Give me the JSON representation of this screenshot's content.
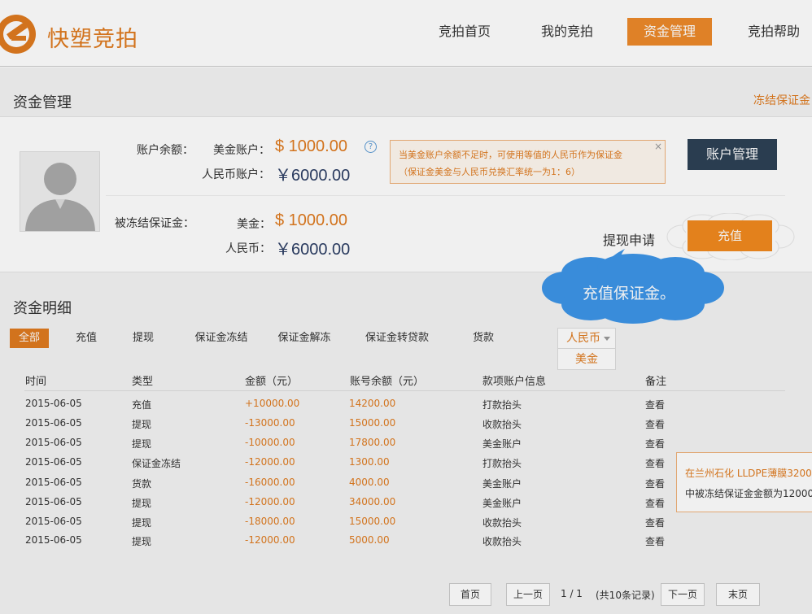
{
  "brand": {
    "name": "快塑竞拍"
  },
  "nav": [
    {
      "label": "竞拍首页",
      "active": false
    },
    {
      "label": "我的竞拍",
      "active": false
    },
    {
      "label": "资金管理",
      "active": true
    },
    {
      "label": "竞拍帮助",
      "active": false
    }
  ],
  "funds": {
    "title": "资金管理",
    "frozen_link": "冻结保证金",
    "balance_label": "账户余额：",
    "usd_label": "美金账户：",
    "usd_value": "$ 1000.00",
    "cny_label": "人民币账户：",
    "cny_value": "￥6000.00",
    "frozen_label": "被冻结保证金：",
    "frozen_usd_label": "美金：",
    "frozen_usd_value": "$ 1000.00",
    "frozen_cny_label": "人民币：",
    "frozen_cny_value": "￥6000.00",
    "help_icon": "?",
    "tip_line1": "当美金账户余额不足时，可使用等值的人民币作为保证金",
    "tip_line2": "（保证金美金与人民币兑换汇率统一为1：6）",
    "tip_close": "×",
    "account_button": "账户管理",
    "withdraw_link": "提现申请",
    "recharge_button": "充值",
    "guide_bubble": "充值保证金。"
  },
  "details": {
    "title": "资金明细",
    "filters": [
      "全部",
      "充值",
      "提现",
      "保证金冻结",
      "保证金解冻",
      "保证金转贷款",
      "货款"
    ],
    "active_filter": "全部",
    "currency_selected": "人民币",
    "currency_option": "美金",
    "columns": [
      "时间",
      "类型",
      "金额（元）",
      "账号余额（元）",
      "款项账户信息",
      "备注"
    ],
    "rows": [
      {
        "date": "2015-06-05",
        "type": "充值",
        "amount": "+10000.00",
        "balance": "14200.00",
        "account": "打款抬头",
        "note": "查看"
      },
      {
        "date": "2015-06-05",
        "type": "提现",
        "amount": "-13000.00",
        "balance": "15000.00",
        "account": "收款抬头",
        "note": "查看"
      },
      {
        "date": "2015-06-05",
        "type": "提现",
        "amount": "-10000.00",
        "balance": "17800.00",
        "account": "美金账户",
        "note": "查看"
      },
      {
        "date": "2015-06-05",
        "type": "保证金冻结",
        "amount": "-12000.00",
        "balance": "1300.00",
        "account": "打款抬头",
        "note": "查看"
      },
      {
        "date": "2015-06-05",
        "type": "货款",
        "amount": "-16000.00",
        "balance": "4000.00",
        "account": "美金账户",
        "note": "查看"
      },
      {
        "date": "2015-06-05",
        "type": "提现",
        "amount": "-12000.00",
        "balance": "34000.00",
        "account": "美金账户",
        "note": "查看"
      },
      {
        "date": "2015-06-05",
        "type": "提现",
        "amount": "-18000.00",
        "balance": "15000.00",
        "account": "收款抬头",
        "note": "查看"
      },
      {
        "date": "2015-06-05",
        "type": "提现",
        "amount": "-12000.00",
        "balance": "5000.00",
        "account": "收款抬头",
        "note": "查看"
      }
    ],
    "tooltip_line1": "在兰州石化   LLDPE薄膜3200",
    "tooltip_line2": "中被冻结保证金金额为12000"
  },
  "pagination": {
    "first": "首页",
    "prev": "上一页",
    "page_info": "1 / 1",
    "total": "(共10条记录)",
    "next": "下一页",
    "last": "末页"
  },
  "colors": {
    "accent": "#e07b1f",
    "navy": "#2d4156",
    "bubble": "#3d95e8"
  }
}
